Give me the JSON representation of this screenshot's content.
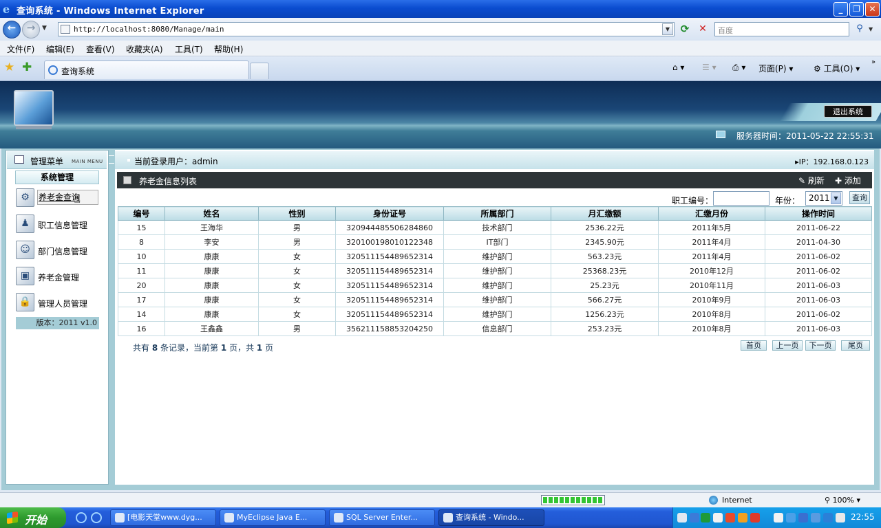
{
  "window": {
    "title": "查询系统 - Windows Internet Explorer",
    "controls": {
      "minimize": "_",
      "maximize": "❐",
      "close": "✕"
    }
  },
  "browser": {
    "address": "http://localhost:8080/Manage/main",
    "search_placeholder": "百度",
    "menu": [
      "文件(F)",
      "编辑(E)",
      "查看(V)",
      "收藏夹(A)",
      "工具(T)",
      "帮助(H)"
    ],
    "tab_title": "查询系统",
    "commands": {
      "page": "页面(P)",
      "tools": "工具(O)"
    },
    "status": {
      "zone": "Internet",
      "zoom": "100%",
      "progress": 1.0
    }
  },
  "header": {
    "logout_label": "退出系统",
    "server_time": "服务器时间：2011-05-22 22:55:31"
  },
  "sidebar": {
    "title": "管理菜单",
    "title_en": "MAIN MENU",
    "section": "系统管理",
    "items": [
      {
        "label": "养老金查询",
        "icon": "gear-icon"
      },
      {
        "label": "职工信息管理",
        "icon": "user-info-icon"
      },
      {
        "label": "部门信息管理",
        "icon": "department-icon"
      },
      {
        "label": "养老金管理",
        "icon": "pension-icon"
      },
      {
        "label": "管理人员管理",
        "icon": "lock-icon"
      }
    ],
    "version": "版本：2011 v1.0"
  },
  "main": {
    "current_user": "当前登录用户：admin",
    "ip": "IP：192.168.0.123",
    "list_title": "养老金信息列表",
    "refresh_label": "刷新",
    "add_label": "添加",
    "filter": {
      "emp_label": "职工编号：",
      "emp_value": "",
      "year_label": "年份：",
      "year_value": "2011",
      "query_label": "查询"
    },
    "table": {
      "columns": [
        "编号",
        "姓名",
        "性别",
        "身份证号",
        "所属部门",
        "月汇缴额",
        "汇缴月份",
        "操作时间"
      ],
      "rows": [
        [
          "15",
          "王海华",
          "男",
          "320944485506284860",
          "技术部门",
          "2536.22元",
          "2011年5月",
          "2011-06-22"
        ],
        [
          "8",
          "李安",
          "男",
          "320100198010122348",
          "IT部门",
          "2345.90元",
          "2011年4月",
          "2011-04-30"
        ],
        [
          "10",
          "康康",
          "女",
          "320511154489652314",
          "维护部门",
          "563.23元",
          "2011年4月",
          "2011-06-02"
        ],
        [
          "11",
          "康康",
          "女",
          "320511154489652314",
          "维护部门",
          "25368.23元",
          "2010年12月",
          "2011-06-02"
        ],
        [
          "20",
          "康康",
          "女",
          "320511154489652314",
          "维护部门",
          "25.23元",
          "2010年11月",
          "2011-06-03"
        ],
        [
          "17",
          "康康",
          "女",
          "320511154489652314",
          "维护部门",
          "566.27元",
          "2010年9月",
          "2011-06-03"
        ],
        [
          "14",
          "康康",
          "女",
          "320511154489652314",
          "维护部门",
          "1256.23元",
          "2010年8月",
          "2011-06-02"
        ],
        [
          "16",
          "王鑫鑫",
          "男",
          "356211158853204250",
          "信息部门",
          "253.23元",
          "2010年8月",
          "2011-06-03"
        ]
      ]
    },
    "pager": {
      "p1": "共有",
      "total": "8",
      "p2": "条记录，当前第",
      "current": "1",
      "p3": "页，共",
      "pages": "1",
      "p4": "页",
      "first": "首页",
      "prev": "上一页",
      "next": "下一页",
      "last": "尾页"
    }
  },
  "taskbar": {
    "start": "开始",
    "tasks": [
      "[电影天堂www.dyg...",
      "MyEclipse Java E...",
      "SQL Server Enter...",
      "查询系统 - Windo..."
    ],
    "clock": "22:55"
  },
  "colors": {
    "titlebar": "#0a4cd0",
    "header_dark": "#1a4676",
    "panel_frame": "#a4ccd6",
    "list_header": "#2d3437"
  }
}
